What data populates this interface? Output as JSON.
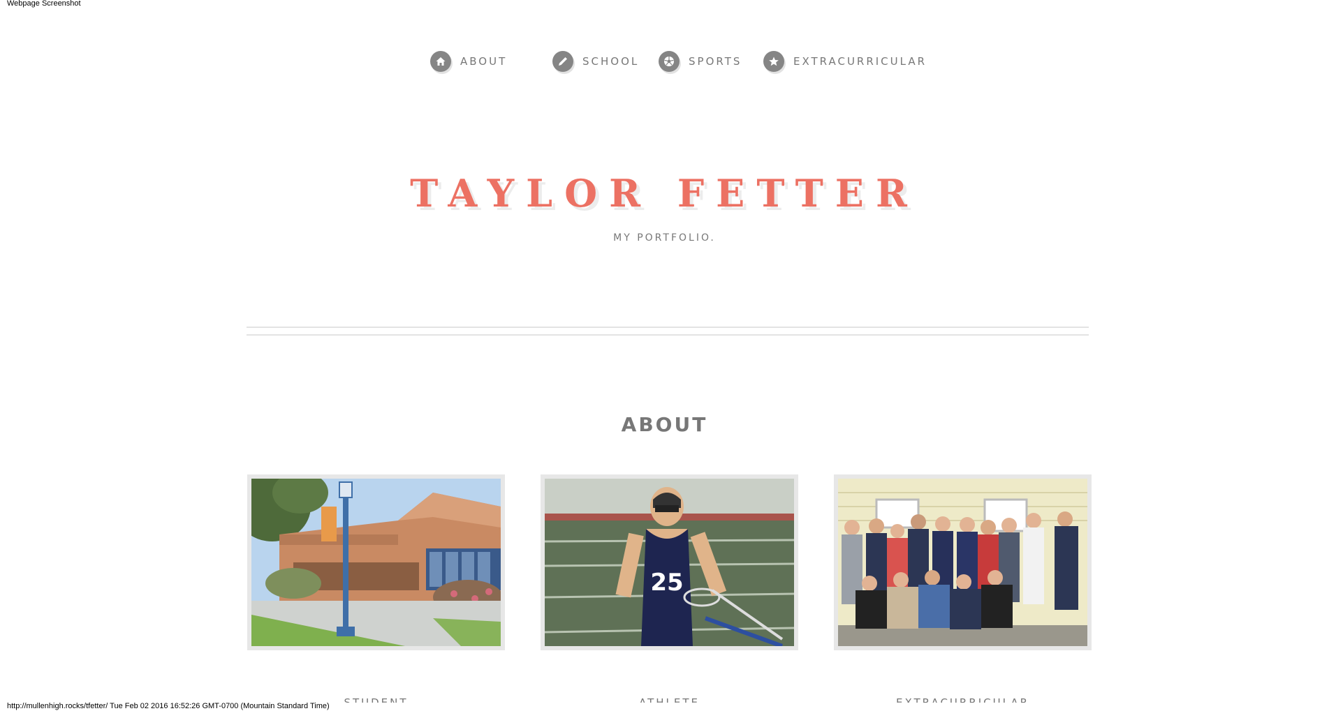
{
  "window": {
    "screenshot_label": "Webpage Screenshot",
    "status_url": "http://mullenhigh.rocks/tfetter/ Tue Feb 02 2016 16:52:26 GMT-0700 (Mountain Standard Time)"
  },
  "nav": {
    "items": [
      {
        "label": "ABOUT",
        "icon": "home-icon"
      },
      {
        "label": "SCHOOL",
        "icon": "pencil-icon"
      },
      {
        "label": "SPORTS",
        "icon": "soccer-ball-icon"
      },
      {
        "label": "EXTRACURRICULAR",
        "icon": "star-icon"
      }
    ]
  },
  "hero": {
    "title": "TAYLOR FETTER",
    "subtitle": "MY PORTFOLIO."
  },
  "about": {
    "title": "ABOUT",
    "cards": [
      {
        "caption": "STUDENT",
        "image": "school-building-photo"
      },
      {
        "caption": "ATHLETE",
        "image": "lacrosse-player-photo"
      },
      {
        "caption": "EXTRACURRICULAR",
        "image": "group-photo"
      }
    ]
  },
  "colors": {
    "accent": "#ec7163",
    "text_gray": "#777777",
    "icon_gray": "#858585",
    "frame_gray": "#e7e7e7"
  }
}
